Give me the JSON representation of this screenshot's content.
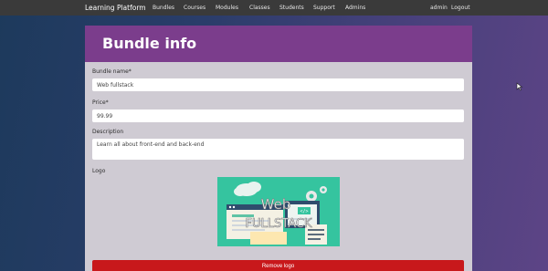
{
  "nav": {
    "brand": "Learning Platform",
    "links": [
      "Bundles",
      "Courses",
      "Modules",
      "Classes",
      "Students",
      "Support",
      "Admins"
    ],
    "user": "admin",
    "logout": "Logout"
  },
  "card": {
    "title": "Bundle info"
  },
  "form": {
    "name_label": "Bundle name*",
    "name_value": "Web fullstack",
    "price_label": "Price*",
    "price_value": "99.99",
    "description_label": "Description",
    "description_value": "Learn all about front-end and back-end",
    "logo_label": "Logo",
    "remove_logo_label": "Remove logo"
  },
  "logo_image": {
    "line1": "Web",
    "line2": "FULLSTACK",
    "badge": "</>"
  },
  "colors": {
    "navbar": "#3a3a3a",
    "header": "#7b3d8c",
    "card": "#cfcbd3",
    "danger": "#c8181b",
    "logo_bg": "#35c49f"
  }
}
